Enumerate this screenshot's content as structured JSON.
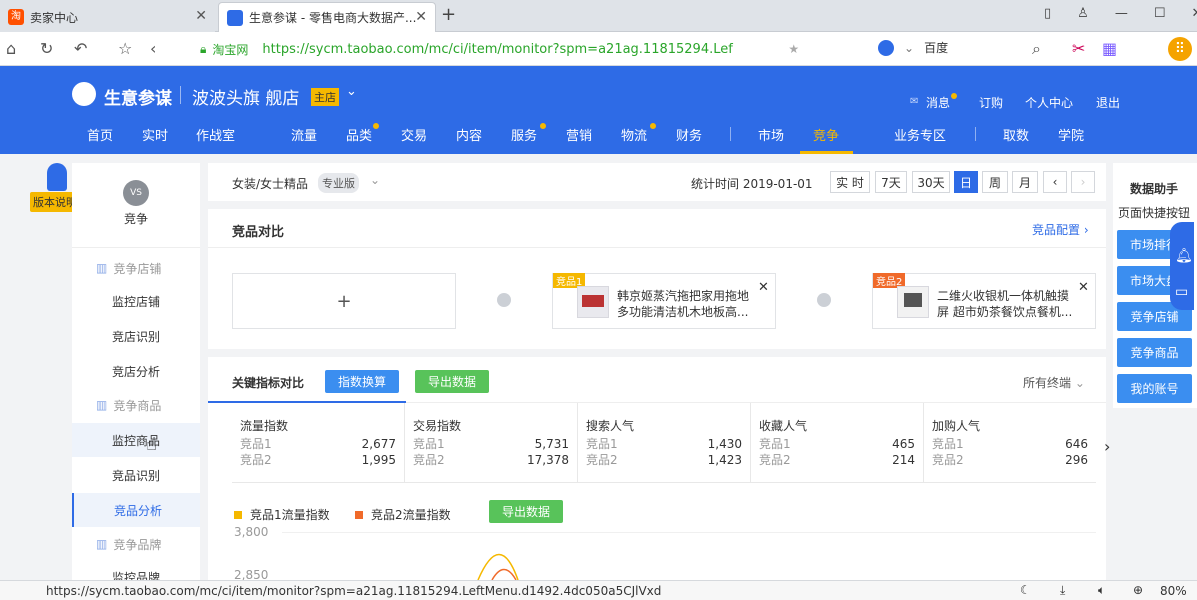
{
  "browser": {
    "tabs": [
      {
        "label": "卖家中心",
        "favicon_color": "#ff5000"
      },
      {
        "label": "生意参谋 - 零售电商大数据产...",
        "favicon_color": "#2e6be6"
      }
    ],
    "new_tab": "+",
    "url_site": "淘宝网",
    "url": "https://sycm.taobao.com/mc/ci/item/monitor?spm=a21ag.11815294.Lef",
    "search_engine": "百度",
    "status_url": "https://sycm.taobao.com/mc/ci/item/monitor?spm=a21ag.11815294.LeftMenu.d1492.4dc050a5CJlVxd",
    "zoom": "80%"
  },
  "header": {
    "brand": "生意参谋",
    "shop": "波波头旗 舰店",
    "shop_badge": "主店",
    "top_links": [
      "消息",
      "订购",
      "个人中心",
      "退出"
    ],
    "nav": [
      "首页",
      "实时",
      "作战室",
      "流量",
      "品类",
      "交易",
      "内容",
      "服务",
      "营销",
      "物流",
      "财务",
      "市场",
      "竞争",
      "业务专区",
      "取数",
      "学院"
    ],
    "active_nav": "竞争"
  },
  "version_badge": "版本说明",
  "sidebar": {
    "title": "竞争",
    "icon_text": "VS",
    "groups": [
      {
        "label": "竞争店铺",
        "items": [
          "监控店铺",
          "竞店识别",
          "竞店分析"
        ]
      },
      {
        "label": "竞争商品",
        "items": [
          "监控商品",
          "竞品识别",
          "竞品分析"
        ]
      },
      {
        "label": "竞争品牌",
        "items": [
          "监控品牌"
        ]
      }
    ],
    "active_item": "竞品分析",
    "hover_item": "监控商品"
  },
  "filter": {
    "category": "女装/女士精品",
    "edition": "专业版",
    "stat_time_label": "统计时间 2019-01-01",
    "periods": [
      "实 时",
      "7天",
      "30天",
      "日",
      "周",
      "月"
    ],
    "active_period": "日"
  },
  "compare": {
    "title": "竞品对比",
    "config_link": "竞品配置",
    "add_label": "+",
    "products": [
      {
        "tag": "竞品1",
        "name": "韩京姬蒸汽拖把家用拖地多功能清洁机木地板高..."
      },
      {
        "tag": "竞品2",
        "name": "二维火收银机一体机触摸屏 超市奶茶餐饮点餐机..."
      }
    ]
  },
  "metrics": {
    "title": "关键指标对比",
    "btn_convert": "指数换算",
    "btn_export": "导出数据",
    "terminal": "所有终端",
    "items": [
      {
        "name": "流量指数",
        "p1_label": "竞品1",
        "p1": "2,677",
        "p2_label": "竞品2",
        "p2": "1,995"
      },
      {
        "name": "交易指数",
        "p1_label": "竞品1",
        "p1": "5,731",
        "p2_label": "竞品2",
        "p2": "17,378"
      },
      {
        "name": "搜索人气",
        "p1_label": "竞品1",
        "p1": "1,430",
        "p2_label": "竞品2",
        "p2": "1,423"
      },
      {
        "name": "收藏人气",
        "p1_label": "竞品1",
        "p1": "465",
        "p2_label": "竞品2",
        "p2": "214"
      },
      {
        "name": "加购人气",
        "p1_label": "竞品1",
        "p1": "646",
        "p2_label": "竞品2",
        "p2": "296"
      }
    ],
    "next_arrow": "›"
  },
  "chart": {
    "legend": [
      {
        "label": "竞品1流量指数",
        "color": "#f5b800"
      },
      {
        "label": "竞品2流量指数",
        "color": "#f06a2a"
      }
    ],
    "export": "导出数据",
    "yticks": [
      "3,800",
      "2,850"
    ]
  },
  "assistant": {
    "title": "数据助手",
    "subtitle": "页面快捷按钮",
    "buttons": [
      "市场排行",
      "市场大盘",
      "竞争店铺",
      "竞争商品",
      "我的账号"
    ]
  },
  "colors": {
    "brand_blue": "#2e6be6",
    "accent_blue": "#3b8ef0",
    "green": "#58c35a",
    "gold": "#f5b800"
  }
}
